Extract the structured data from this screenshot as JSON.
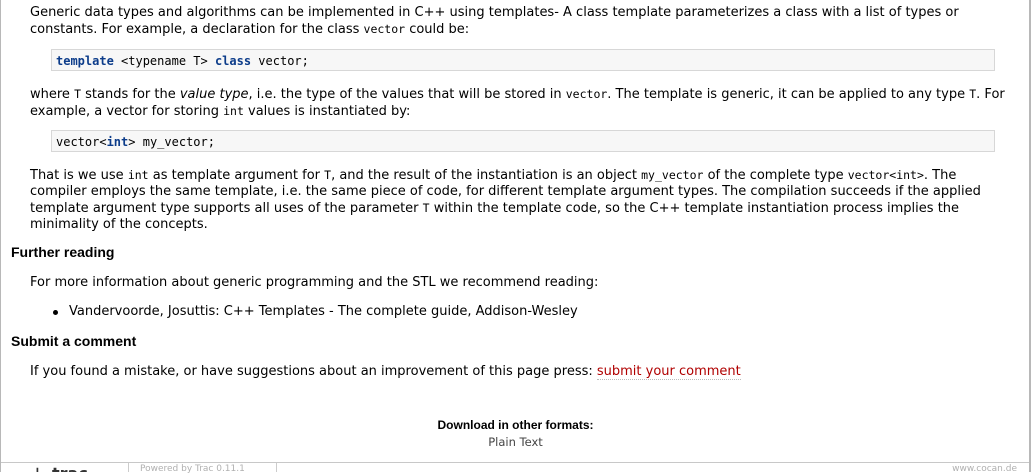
{
  "intro": {
    "text1": "Generic data types and algorithms can be implemented in C++ using templates- A class template parameterizes a class with a list of types or constants. For example, a declaration for the class ",
    "code_vector": "vector",
    "text2": " could be:"
  },
  "code1": {
    "kw_template": "template",
    "mid": " <typename T> ",
    "kw_class": "class",
    "rest": " vector;"
  },
  "where": {
    "text1": "where ",
    "code_T": "T",
    "text2": " stands for the ",
    "em_value_type": "value type",
    "text3": ", i.e. the type of the values that will be stored in ",
    "code_vector": "vector",
    "text4": ". The template is generic, it can be applied to any type ",
    "code_T2": "T",
    "text5": ". For example, a vector for storing ",
    "code_int": "int",
    "text6": " values is instantiated by:"
  },
  "code2": {
    "pre": "vector<",
    "kw_int": "int",
    "post": "> my_vector;"
  },
  "thatis": {
    "text1": "That is we use ",
    "code_int": "int",
    "text2": " as template argument for ",
    "code_T": "T",
    "text3": ", and the result of the instantiation is an object ",
    "code_my_vector": "my_vector",
    "text4": " of the complete type ",
    "code_vector_int": "vector<int>",
    "text5": ". The compiler employs the same template, i.e. the same piece of code, for different template argument types. The compilation succeeds if the applied template argument type supports all uses of the parameter ",
    "code_T2": "T",
    "text6": " within the template code, so the C++ template instantiation process implies the minimality of the concepts."
  },
  "further": {
    "heading": "Further reading",
    "intro": "For more information about generic programming and the STL we recommend reading:",
    "items": [
      "Vandervoorde, Josuttis: C++ Templates - The complete guide, Addison-Wesley"
    ]
  },
  "submit": {
    "heading": "Submit a comment",
    "text": "If you found a mistake, or have suggestions about an improvement of this page press: ",
    "link": "submit your comment"
  },
  "download": {
    "title": "Download in other formats:",
    "plain_text": "Plain Text"
  },
  "footer": {
    "logo": "trac",
    "powered": "Powered by Trac 0.11.1",
    "site": "www.cocan.de"
  },
  "colors": {
    "link": "#b00000",
    "keyword": "#0c3c8a",
    "code_bg": "#f7f7f7"
  }
}
